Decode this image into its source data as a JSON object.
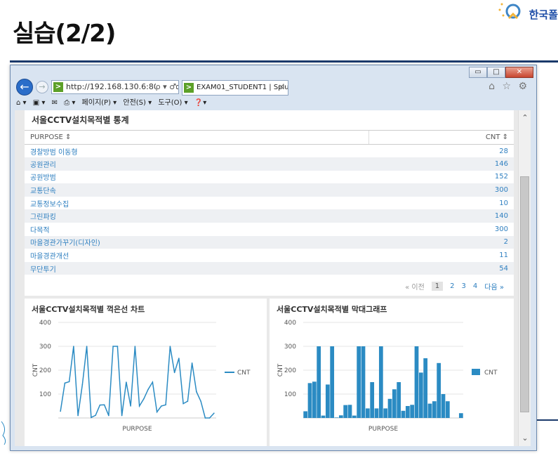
{
  "slide": {
    "title": "실습(2/2)",
    "logo_text": "한국폴"
  },
  "browser": {
    "url": "http://192.168.130.6:8000/kc",
    "url_tools": "ρ ▾ ♂",
    "tab_title": "EXAM01_STUDENT1 | Splu...",
    "command_bar": [
      "페이지(P) ▾",
      "안전(S) ▾",
      "도구(O) ▾"
    ],
    "right_icons": "⌂ ☆ ⚙"
  },
  "table": {
    "title": "서울CCTV설치목적별 통계",
    "columns": [
      "PURPOSE",
      "CNT"
    ],
    "rows": [
      {
        "purpose": "경찰방범 이동형",
        "cnt": "28"
      },
      {
        "purpose": "공원관리",
        "cnt": "146"
      },
      {
        "purpose": "공원방범",
        "cnt": "152"
      },
      {
        "purpose": "교통단속",
        "cnt": "300"
      },
      {
        "purpose": "교통정보수집",
        "cnt": "10"
      },
      {
        "purpose": "그린파킹",
        "cnt": "140"
      },
      {
        "purpose": "다목적",
        "cnt": "300"
      },
      {
        "purpose": "마을경관가꾸기(디자인)",
        "cnt": "2"
      },
      {
        "purpose": "마을경관개선",
        "cnt": "11"
      },
      {
        "purpose": "무단투기",
        "cnt": "54"
      }
    ],
    "pager": {
      "prev": "« 이전",
      "pages": [
        "1",
        "2",
        "3",
        "4"
      ],
      "next": "다음 »"
    }
  },
  "chart_data": [
    {
      "type": "line",
      "title": "서울CCTV설치목적별 꺽은선 차트",
      "xlabel": "PURPOSE",
      "ylabel": "CNT",
      "ylim": [
        0,
        400
      ],
      "yticks": [
        100,
        200,
        300,
        400
      ],
      "legend": "right",
      "series": [
        {
          "name": "CNT",
          "color": "#2b8bc3",
          "values": [
            28,
            146,
            152,
            300,
            10,
            140,
            300,
            2,
            11,
            54,
            55,
            10,
            300,
            300,
            10,
            150,
            50,
            300,
            50,
            80,
            120,
            150,
            25,
            50,
            55,
            300,
            190,
            250,
            60,
            70,
            230,
            110,
            70,
            0,
            0,
            20
          ]
        }
      ]
    },
    {
      "type": "bar",
      "title": "서울CCTV설치목적별 막대그래프",
      "xlabel": "PURPOSE",
      "ylabel": "CNT",
      "ylim": [
        0,
        400
      ],
      "yticks": [
        100,
        200,
        300,
        400
      ],
      "legend": "right",
      "series": [
        {
          "name": "CNT",
          "color": "#2b8bc3",
          "values": [
            28,
            146,
            152,
            300,
            10,
            140,
            300,
            2,
            11,
            54,
            55,
            10,
            300,
            300,
            40,
            150,
            40,
            300,
            40,
            80,
            120,
            150,
            30,
            50,
            55,
            300,
            190,
            250,
            60,
            70,
            230,
            100,
            70,
            0,
            0,
            20
          ]
        }
      ]
    }
  ]
}
